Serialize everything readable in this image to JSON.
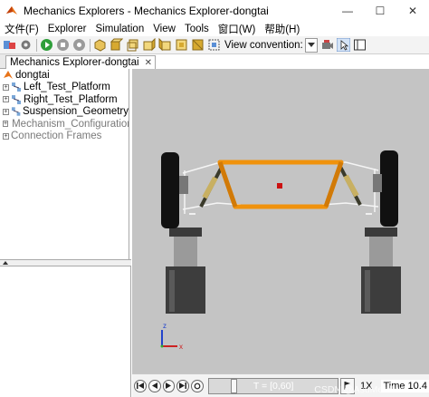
{
  "window": {
    "title": "Mechanics Explorers - Mechanics Explorer-dongtai",
    "minimize": "—",
    "maximize": "☐",
    "close": "✕"
  },
  "menu": {
    "items": [
      "文件(F)",
      "Explorer",
      "Simulation",
      "View",
      "Tools",
      "窗口(W)",
      "帮助(H)"
    ]
  },
  "toolbar": {
    "view_convention_label": "View convention:"
  },
  "tab": {
    "label": "Mechanics Explorer-dongtai",
    "close": "✕"
  },
  "tree": {
    "root": "dongtai",
    "children": [
      {
        "label": "Left_Test_Platform",
        "muted": false
      },
      {
        "label": "Right_Test_Platform",
        "muted": false
      },
      {
        "label": "Suspension_Geometry",
        "muted": false
      },
      {
        "label": "Mechanism_Configuration",
        "muted": true
      },
      {
        "label": "Connection Frames",
        "muted": true
      }
    ]
  },
  "viewport": {
    "axis_z": "z",
    "axis_x": "x"
  },
  "playback": {
    "range_label": "T = [0,60]",
    "speed": "1X",
    "time_label": "Time",
    "time_value": "10.4",
    "watermark": "CSDN @AsuMerdlus"
  },
  "colors": {
    "background_3d": "#c4c4c4",
    "frame_orange": "#f0920c",
    "wheel": "#111111",
    "platform_gray": "#4a4a4a",
    "marker_red": "#cc1111"
  },
  "icons": [
    "new-model-icon",
    "settings-icon",
    "play-icon",
    "stop-icon",
    "record-icon",
    "view-isometric-icon",
    "view-front-icon",
    "view-back-icon",
    "view-left-icon",
    "view-right-icon",
    "view-top-icon",
    "view-bottom-icon",
    "zoom-fit-icon",
    "dropdown-icon",
    "camera-icon",
    "select-cursor-icon",
    "layout-icon"
  ]
}
